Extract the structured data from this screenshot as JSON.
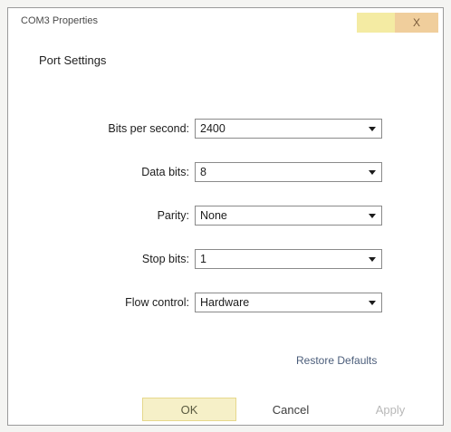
{
  "window": {
    "title": "COM3 Properties",
    "close_label": "X"
  },
  "tab": {
    "label": "Port Settings"
  },
  "settings": [
    {
      "label": "Bits per second:",
      "value": "2400"
    },
    {
      "label": "Data bits:",
      "value": "8"
    },
    {
      "label": "Parity:",
      "value": "None"
    },
    {
      "label": "Stop bits:",
      "value": "1"
    },
    {
      "label": "Flow control:",
      "value": "Hardware"
    }
  ],
  "restore_label": "Restore Defaults",
  "buttons": {
    "ok": "OK",
    "cancel": "Cancel",
    "apply": "Apply"
  },
  "colors": {
    "ok_bg": "#f6f0c8",
    "close_bg": "#f0ce9c",
    "link": "#4b5d7a"
  }
}
